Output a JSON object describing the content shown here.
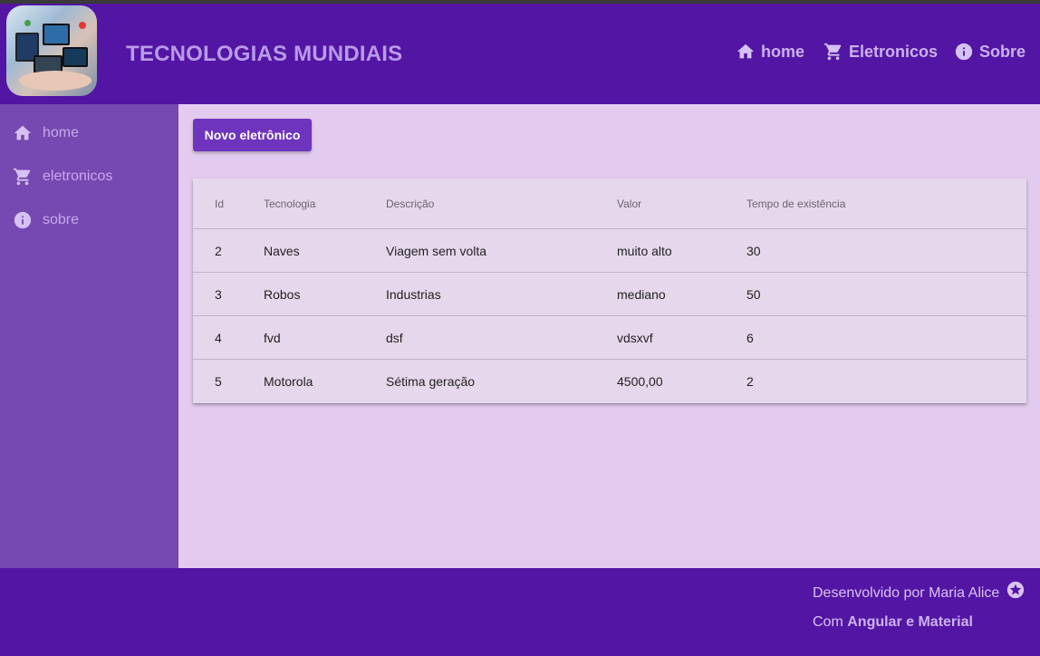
{
  "header": {
    "title": "TECNOLOGIAS MUNDIAIS",
    "logo_icon": "tech-devices-logo",
    "nav": [
      {
        "label": "home",
        "icon": "home-icon"
      },
      {
        "label": "Eletronicos",
        "icon": "cart-icon"
      },
      {
        "label": "Sobre",
        "icon": "info-icon"
      }
    ]
  },
  "sidebar": {
    "items": [
      {
        "label": "home",
        "icon": "home-icon"
      },
      {
        "label": "eletronicos",
        "icon": "cart-icon"
      },
      {
        "label": "sobre",
        "icon": "info-icon"
      }
    ]
  },
  "main": {
    "new_button_label": "Novo eletrônico",
    "table": {
      "headers": [
        "Id",
        "Tecnologia",
        "Descrição",
        "Valor",
        "Tempo de existência"
      ],
      "rows": [
        [
          "2",
          "Naves",
          "Viagem sem volta",
          "muito alto",
          "30"
        ],
        [
          "3",
          "Robos",
          "Industrias",
          "mediano",
          "50"
        ],
        [
          "4",
          "fvd",
          "dsf",
          "vdsxvf",
          "6"
        ],
        [
          "5",
          "Motorola",
          "Sétima geração",
          "4500,00",
          "2"
        ]
      ]
    }
  },
  "footer": {
    "line1": "Desenvolvido por Maria Alice",
    "line2_prefix": "Com",
    "line2_bold": "Angular e Material",
    "icon": "star-circle-icon"
  },
  "colors": {
    "header_bg": "#5315a4",
    "sidebar_bg": "#7648b1",
    "content_bg": "#e3cbef",
    "button_bg": "#6e34bd"
  }
}
